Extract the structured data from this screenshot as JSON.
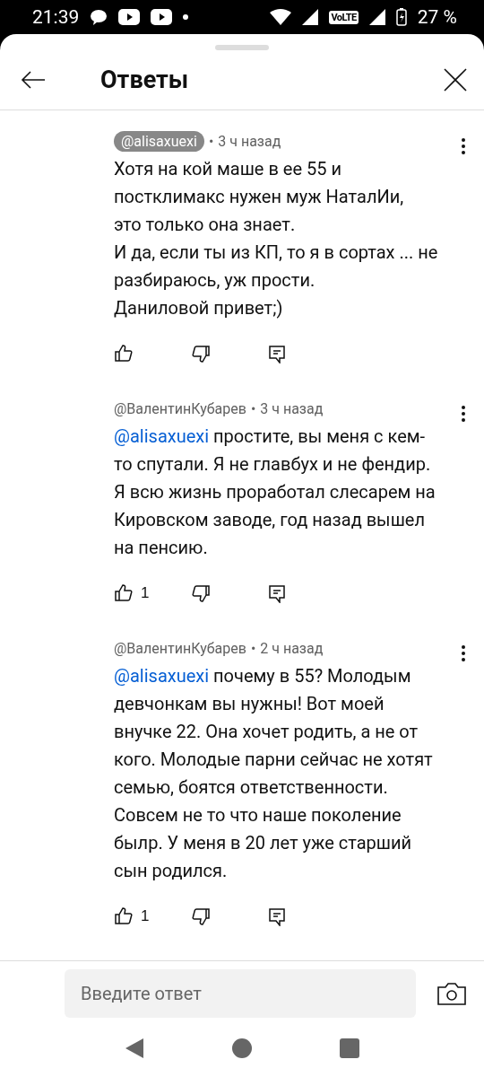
{
  "status_bar": {
    "time": "21:39",
    "network_label": "VoLTE",
    "battery": "27 %"
  },
  "header": {
    "title": "Ответы"
  },
  "comments": [
    {
      "author": "@alisaxuexi",
      "author_highlighted": true,
      "separator": "•",
      "time": "3 ч назад",
      "text": "Хотя на кой маше в ее 55 и постклимакс нужен муж НаталИи,\nэто только она знает.\nИ да, если ты из КП, то я в сортах ... не разбираюсь, уж прости.\nДаниловой привет;)"
    },
    {
      "author": "@ВалентинКубарев",
      "author_highlighted": false,
      "separator": "•",
      "time": "3 ч назад",
      "mention": "@alisaxuexi",
      "text": "простите, вы меня с кем-то спутали. Я не главбух и не фендир. Я всю жизнь проработал слесарем на Кировском заводе, год назад вышел на пенсию.",
      "likes": "1"
    },
    {
      "author": "@ВалентинКубарев",
      "author_highlighted": false,
      "separator": "•",
      "time": "2 ч назад",
      "mention": "@alisaxuexi",
      "text": "почему в 55? Молодым девчонкам вы нужны! Вот моей внучке 22. Она хочет родить, а не от кого. Молодые парни сейчас не хотят семью, боятся ответственности. Совсем не то что наше поколение былр. У меня в 20 лет уже старший сын родился.",
      "likes": "1"
    }
  ],
  "reply_box": {
    "placeholder": "Введите ответ"
  }
}
